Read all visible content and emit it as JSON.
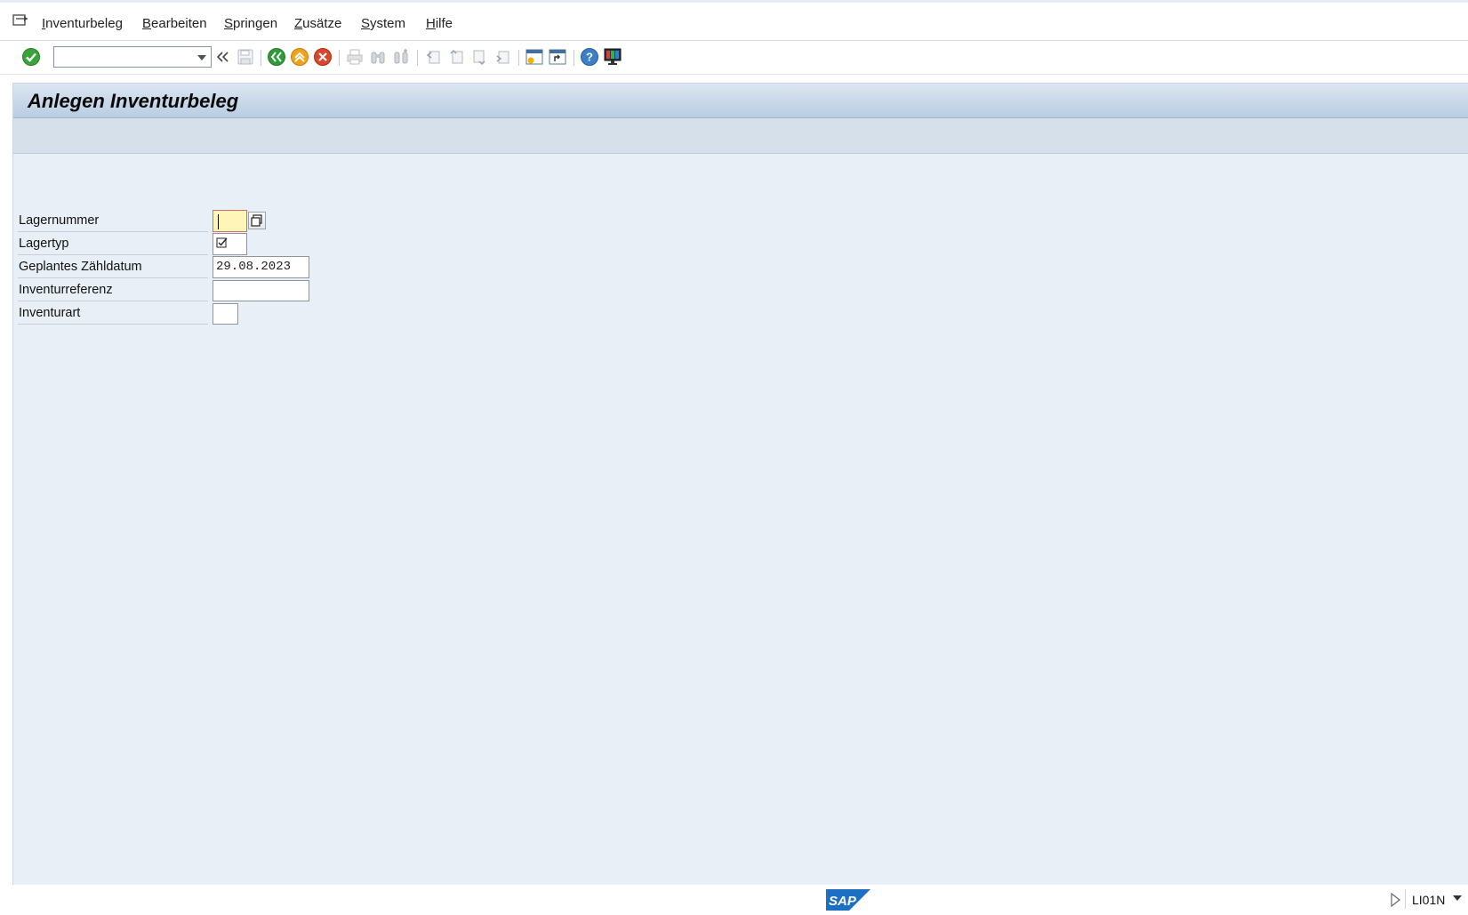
{
  "menubar": {
    "items": [
      {
        "label": "Inventurbeleg"
      },
      {
        "label": "Bearbeiten"
      },
      {
        "label": "Springen"
      },
      {
        "label": "Zusätze"
      },
      {
        "label": "System"
      },
      {
        "label": "Hilfe"
      }
    ]
  },
  "toolbar": {
    "command_field_value": "",
    "icons": [
      "enter-icon",
      "back-double-arrow-icon",
      "save-icon",
      "back-icon",
      "exit-icon",
      "cancel-icon",
      "print-icon",
      "find-icon",
      "find-next-icon",
      "first-page-icon",
      "previous-page-icon",
      "next-page-icon",
      "last-page-icon",
      "new-session-icon",
      "create-shortcut-icon",
      "help-icon",
      "customize-layout-icon"
    ]
  },
  "screen": {
    "title": "Anlegen Inventurbeleg"
  },
  "form": {
    "fields": [
      {
        "label": "Lagernummer",
        "value": ""
      },
      {
        "label": "Lagertyp",
        "value": ""
      },
      {
        "label": "Geplantes Zähldatum",
        "value": "29.08.2023"
      },
      {
        "label": "Inventurreferenz",
        "value": ""
      },
      {
        "label": "Inventurart",
        "value": ""
      }
    ]
  },
  "statusbar": {
    "logo": "SAP",
    "transaction": "LI01N"
  },
  "colors": {
    "title_bar": "#c6d6e7",
    "body_bg": "#e8eff6",
    "required_field": "#fff5b8",
    "enter_green": "#3aa33a",
    "back_green": "#2f9a3a",
    "exit_orange": "#f0a21a",
    "cancel_red": "#d9462b",
    "sap_blue": "#1d6fc4"
  }
}
